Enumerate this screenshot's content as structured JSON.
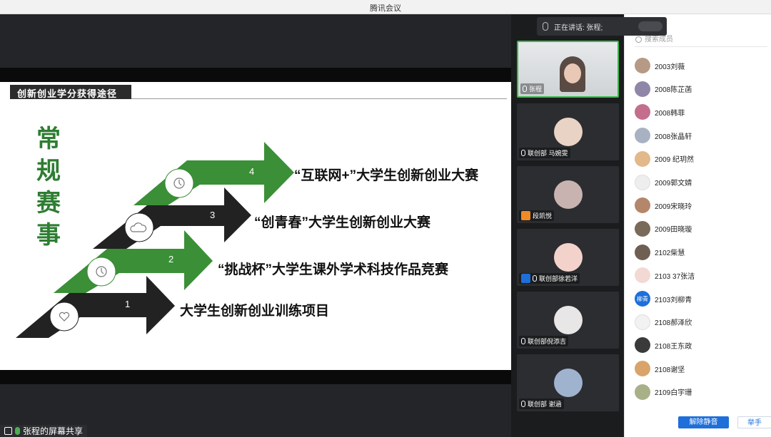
{
  "window": {
    "title": "腾讯会议"
  },
  "speaking": {
    "label": "正在讲话: 张程;"
  },
  "slide": {
    "header": "创新创业学分获得途径",
    "big_title": [
      "常",
      "规",
      "赛",
      "事"
    ],
    "items": [
      {
        "num": "4",
        "label": "“互联网+”大学生创新创业大赛"
      },
      {
        "num": "3",
        "label": "“创青春”大学生创新创业大赛"
      },
      {
        "num": "2",
        "label": "“挑战杯”大学生课外学术科技作品竞赛"
      },
      {
        "num": "1",
        "label": "大学生创新创业训练项目"
      }
    ]
  },
  "share_footer": {
    "label": "张程的屏幕共享"
  },
  "video_tiles": [
    {
      "name": "张程",
      "active": true
    },
    {
      "name": "联创部 马婉雯"
    },
    {
      "name": "段凯悦"
    },
    {
      "name": "联创部徐若洋"
    },
    {
      "name": "联创部倪添吉"
    },
    {
      "name": "联创部 谢涵"
    }
  ],
  "members_panel": {
    "search_placeholder": "搜索成员",
    "members": [
      {
        "name": "2003刘薇",
        "avatar": "#b79a86"
      },
      {
        "name": "2008陈芷菡",
        "avatar": "#8f86a8"
      },
      {
        "name": "2008韩菲",
        "avatar": "#c46e8e"
      },
      {
        "name": "2008张晶轩",
        "avatar": "#a9b2c3"
      },
      {
        "name": "2009 纪玥然",
        "avatar": "#e3b88a"
      },
      {
        "name": "2009郭文婧",
        "avatar": "#eeeeee"
      },
      {
        "name": "2009宋晓玲",
        "avatar": "#b4866a"
      },
      {
        "name": "2009田晓璇",
        "avatar": "#7a6a5a"
      },
      {
        "name": "2102柴慧",
        "avatar": "#6f5f52"
      },
      {
        "name": "2103 37张洁",
        "avatar": "#f3d9d3"
      },
      {
        "name": "2103刘柳青",
        "avatar": "#1e6fd9",
        "initials": "柳青"
      },
      {
        "name": "2108郝泽欣",
        "avatar": "#f2f2f2"
      },
      {
        "name": "2108王东政",
        "avatar": "#3a3a3a"
      },
      {
        "name": "2108谢坚",
        "avatar": "#d9a46a"
      },
      {
        "name": "2109白宇珊",
        "avatar": "#a8b088"
      }
    ],
    "unmute_all_label": "解除静音",
    "raise_hand_label": "举手"
  }
}
